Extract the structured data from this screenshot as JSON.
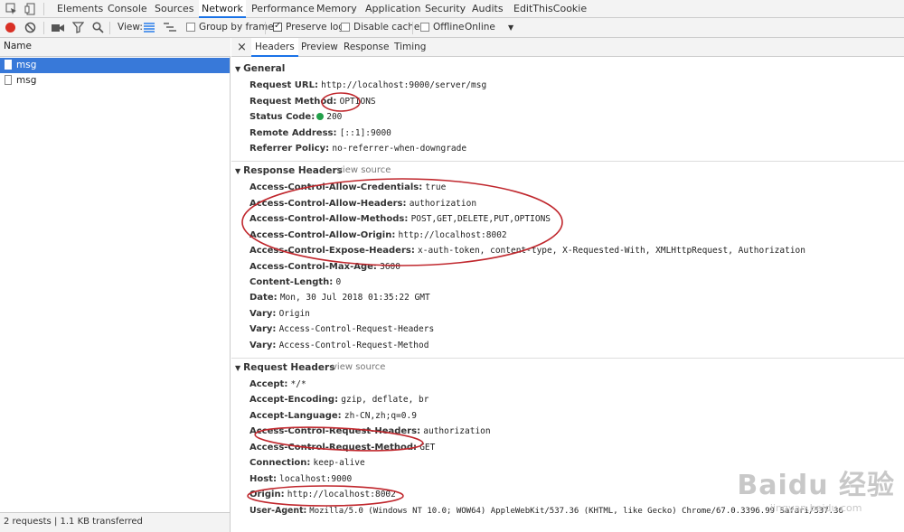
{
  "devtools": {
    "tabs": [
      "Elements",
      "Console",
      "Sources",
      "Network",
      "Performance",
      "Memory",
      "Application",
      "Security",
      "Audits",
      "EditThisCookie"
    ],
    "active_tab": "Network"
  },
  "toolbar": {
    "view_label": "View:",
    "group_by_frame": "Group by frame",
    "preserve_log": "Preserve log",
    "disable_cache": "Disable cache",
    "offline": "Offline",
    "online": "Online",
    "dropdown_arrow": "▼"
  },
  "list": {
    "header": "Name",
    "items": [
      "msg",
      "msg"
    ],
    "status": "2 requests  |  1.1 KB transferred"
  },
  "detail": {
    "close": "×",
    "tabs": [
      "Headers",
      "Preview",
      "Response",
      "Timing"
    ],
    "general": {
      "title": "General",
      "rows": [
        {
          "k": "Request URL:",
          "v": "http://localhost:9000/server/msg"
        },
        {
          "k": "Request Method:",
          "v": "OPTIONS"
        },
        {
          "k": "Status Code:",
          "v": "200"
        },
        {
          "k": "Remote Address:",
          "v": "[::1]:9000"
        },
        {
          "k": "Referrer Policy:",
          "v": "no-referrer-when-downgrade"
        }
      ]
    },
    "response": {
      "title": "Response Headers",
      "view_source": "view source",
      "rows": [
        {
          "k": "Access-Control-Allow-Credentials:",
          "v": "true"
        },
        {
          "k": "Access-Control-Allow-Headers:",
          "v": "authorization"
        },
        {
          "k": "Access-Control-Allow-Methods:",
          "v": "POST,GET,DELETE,PUT,OPTIONS"
        },
        {
          "k": "Access-Control-Allow-Origin:",
          "v": "http://localhost:8002"
        },
        {
          "k": "Access-Control-Expose-Headers:",
          "v": "x-auth-token, content-type, X-Requested-With, XMLHttpRequest, Authorization"
        },
        {
          "k": "Access-Control-Max-Age:",
          "v": "3600"
        },
        {
          "k": "Content-Length:",
          "v": "0"
        },
        {
          "k": "Date:",
          "v": "Mon, 30 Jul 2018 01:35:22 GMT"
        },
        {
          "k": "Vary:",
          "v": "Origin"
        },
        {
          "k": "Vary:",
          "v": "Access-Control-Request-Headers"
        },
        {
          "k": "Vary:",
          "v": "Access-Control-Request-Method"
        }
      ]
    },
    "request": {
      "title": "Request Headers",
      "view_source": "view source",
      "rows": [
        {
          "k": "Accept:",
          "v": "*/*"
        },
        {
          "k": "Accept-Encoding:",
          "v": "gzip, deflate, br"
        },
        {
          "k": "Accept-Language:",
          "v": "zh-CN,zh;q=0.9"
        },
        {
          "k": "Access-Control-Request-Headers:",
          "v": "authorization"
        },
        {
          "k": "Access-Control-Request-Method:",
          "v": "GET"
        },
        {
          "k": "Connection:",
          "v": "keep-alive"
        },
        {
          "k": "Host:",
          "v": "localhost:9000"
        },
        {
          "k": "Origin:",
          "v": "http://localhost:8002"
        },
        {
          "k": "User-Agent:",
          "v": "Mozilla/5.0 (Windows NT 10.0; WOW64) AppleWebKit/537.36 (KHTML, like Gecko) Chrome/67.0.3396.99 Safari/537.36"
        }
      ]
    }
  },
  "watermark": {
    "brand": "Baidu 经验",
    "url": "jingyan.baidu.com"
  },
  "colors": {
    "accent": "#1a73e8",
    "selected": "#3879d9",
    "record": "#d93025",
    "status_ok": "#22a04a",
    "annotation": "#c0272d"
  }
}
